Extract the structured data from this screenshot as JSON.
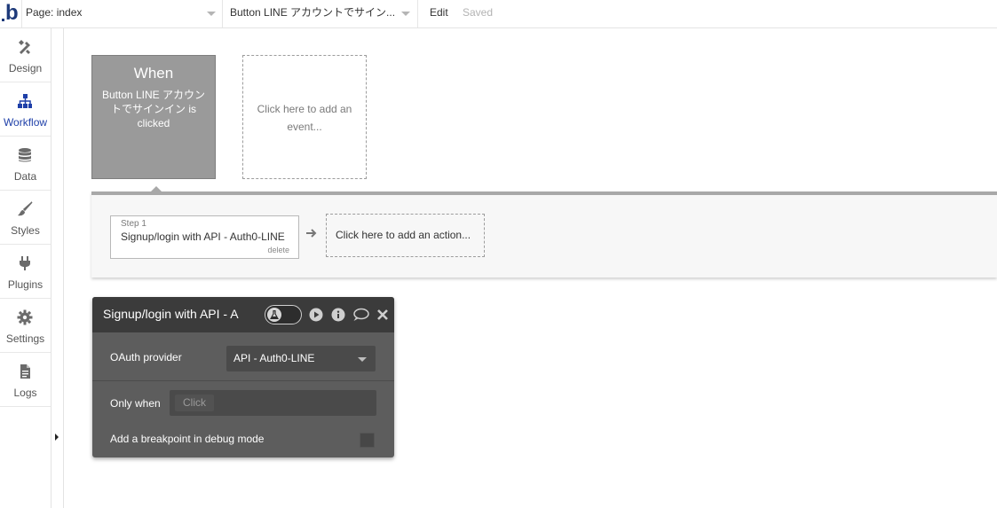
{
  "topbar": {
    "logo": "b",
    "page_select": "Page: index",
    "element_select": "Button LINE アカウントでサイン...",
    "edit": "Edit",
    "saved": "Saved"
  },
  "sidebar": {
    "items": [
      {
        "label": "Design",
        "icon": "design-icon"
      },
      {
        "label": "Workflow",
        "icon": "workflow-icon",
        "active": true
      },
      {
        "label": "Data",
        "icon": "database-icon"
      },
      {
        "label": "Styles",
        "icon": "brush-icon"
      },
      {
        "label": "Plugins",
        "icon": "plug-icon"
      },
      {
        "label": "Settings",
        "icon": "gear-icon"
      },
      {
        "label": "Logs",
        "icon": "document-icon"
      }
    ],
    "active_color": "#1e3fa8"
  },
  "event": {
    "title": "When",
    "description": "Button LINE アカウントでサインイン is clicked",
    "add_event": "Click here to add an event..."
  },
  "actions": {
    "step_number": "Step 1",
    "step_name": "Signup/login with API - Auth0-LINE",
    "delete": "delete",
    "add_action": "Click here to add an action..."
  },
  "editor": {
    "title": "Signup/login with API - A",
    "oauth_label": "OAuth provider",
    "oauth_value": "API - Auth0-LINE",
    "only_when_label": "Only when",
    "only_when_placeholder": "Click",
    "breakpoint_label": "Add a breakpoint in debug mode"
  }
}
